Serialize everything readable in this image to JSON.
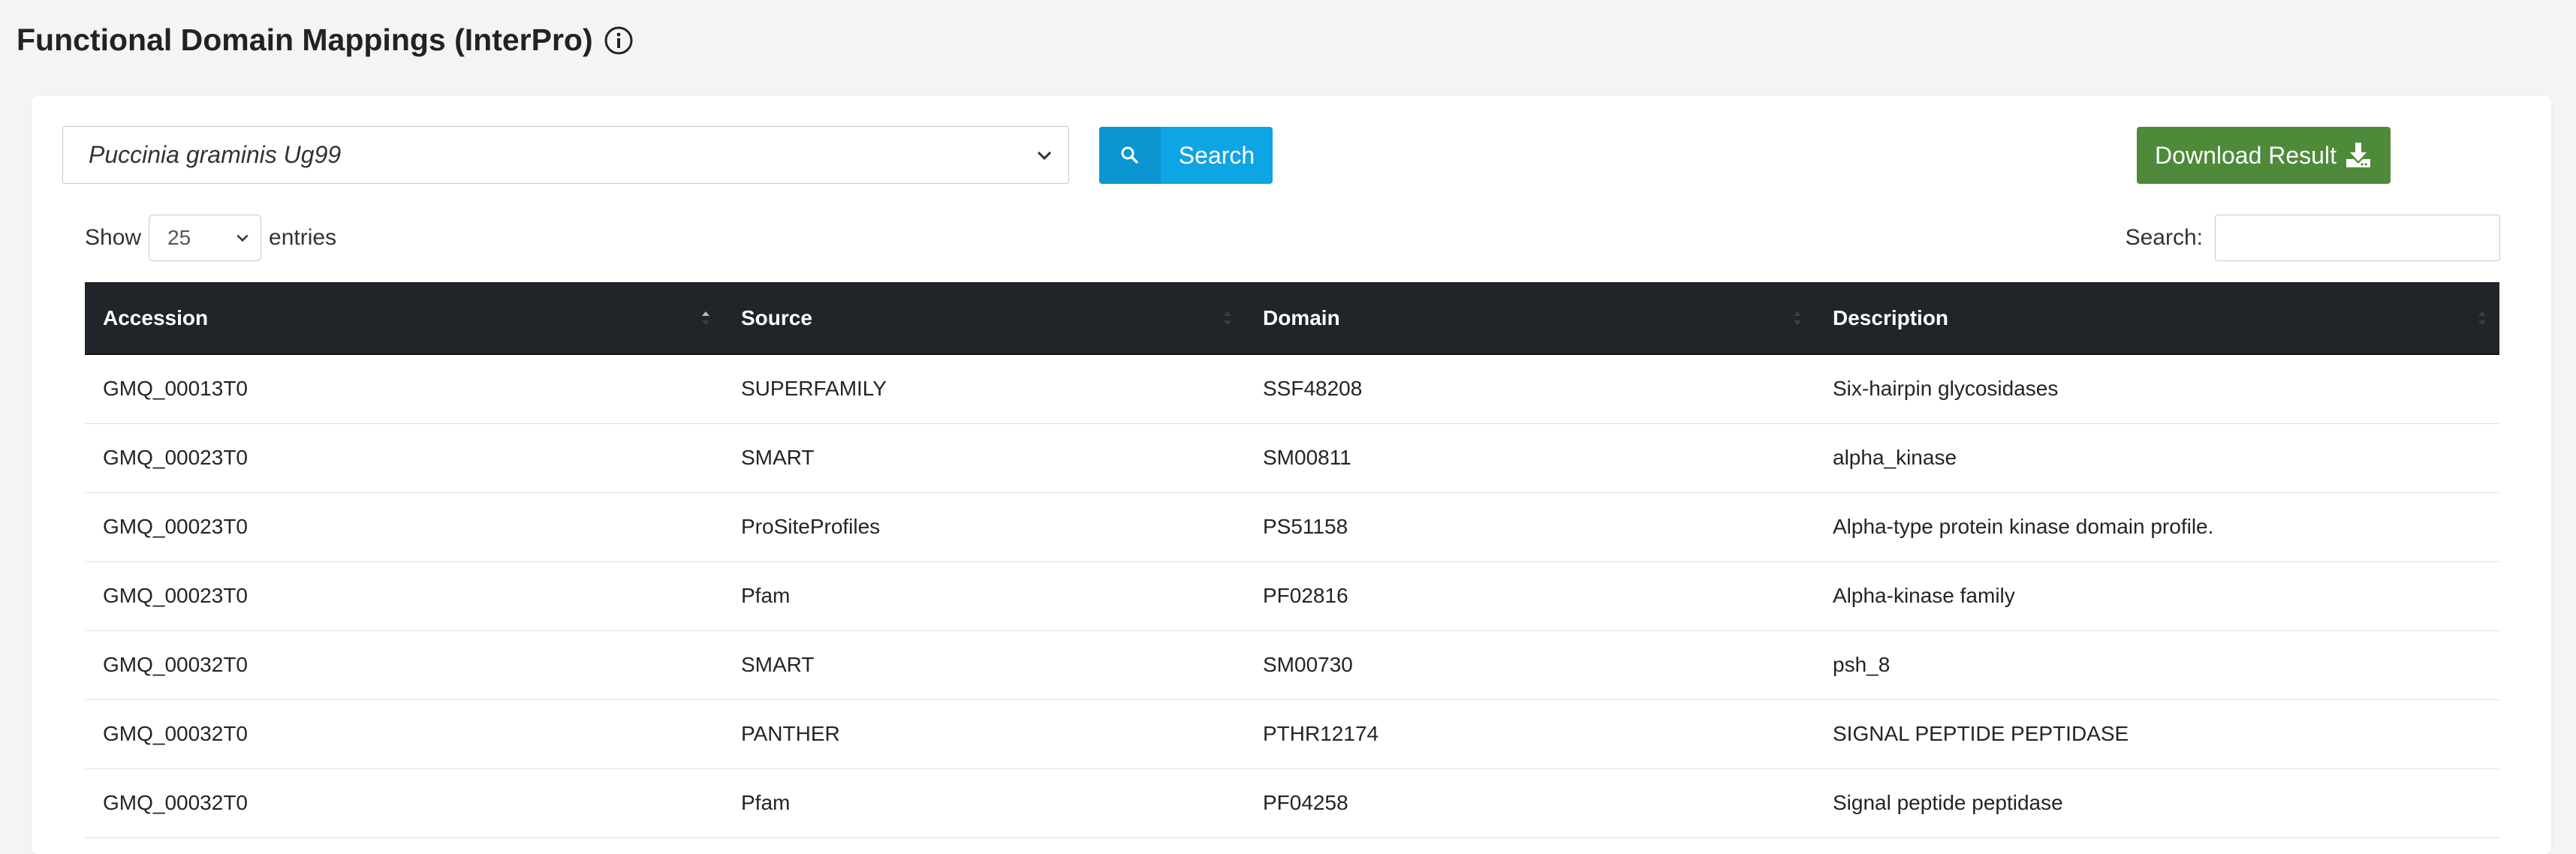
{
  "page": {
    "title": "Functional Domain Mappings (InterPro)",
    "info_icon": "info-circle-icon"
  },
  "controls": {
    "species_selected": "Puccinia graminis Ug99",
    "search_button_label": "Search",
    "search_icon": "search-icon",
    "download_button_label": "Download Result",
    "download_icon": "download-icon",
    "colors": {
      "search_button": "#0ea5e4",
      "search_icon_bg": "#0b96d2",
      "download_button": "#4e8a3a",
      "table_header": "#212529"
    }
  },
  "table_controls": {
    "show_label": "Show",
    "entries_value": "25",
    "entries_label": "entries",
    "search_label": "Search:",
    "search_value": ""
  },
  "table": {
    "columns": [
      "Accession",
      "Source",
      "Domain",
      "Description"
    ],
    "sorted_column": "Accession",
    "sort_direction": "ascending",
    "rows": [
      [
        "GMQ_00013T0",
        "SUPERFAMILY",
        "SSF48208",
        "Six-hairpin glycosidases"
      ],
      [
        "GMQ_00023T0",
        "SMART",
        "SM00811",
        "alpha_kinase"
      ],
      [
        "GMQ_00023T0",
        "ProSiteProfiles",
        "PS51158",
        "Alpha-type protein kinase domain profile."
      ],
      [
        "GMQ_00023T0",
        "Pfam",
        "PF02816",
        "Alpha-kinase family"
      ],
      [
        "GMQ_00032T0",
        "SMART",
        "SM00730",
        "psh_8"
      ],
      [
        "GMQ_00032T0",
        "PANTHER",
        "PTHR12174",
        "SIGNAL PEPTIDE PEPTIDASE"
      ],
      [
        "GMQ_00032T0",
        "Pfam",
        "PF04258",
        "Signal peptide peptidase"
      ]
    ]
  }
}
